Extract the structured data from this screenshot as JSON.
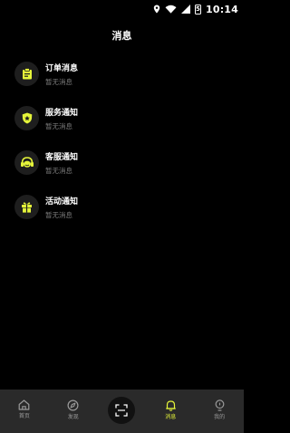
{
  "status_bar": {
    "time": "10:14",
    "battery_level": "5",
    "icons": [
      "location-icon",
      "wifi-icon",
      "signal-icon",
      "battery-icon"
    ]
  },
  "header": {
    "title": "消息"
  },
  "messages": [
    {
      "icon": "order-clipboard-icon",
      "title": "订单消息",
      "subtitle": "暂无消息"
    },
    {
      "icon": "service-shield-icon",
      "title": "服务通知",
      "subtitle": "暂无消息"
    },
    {
      "icon": "customer-service-headset-icon",
      "title": "客服通知",
      "subtitle": "暂无消息"
    },
    {
      "icon": "activity-gift-icon",
      "title": "活动通知",
      "subtitle": "暂无消息"
    }
  ],
  "tabs": [
    {
      "icon": "home-icon",
      "label": "首页"
    },
    {
      "icon": "discover-compass-icon",
      "label": "发现"
    },
    {
      "icon": "scan-icon",
      "label": ""
    },
    {
      "icon": "bell-icon",
      "label": "消息",
      "active": true
    },
    {
      "icon": "profile-icon",
      "label": "我的"
    }
  ],
  "colors": {
    "accent": "#e5f53a",
    "background": "#000000",
    "tab_bar": "#2a2a2a",
    "muted_text": "#7a7a7a"
  }
}
